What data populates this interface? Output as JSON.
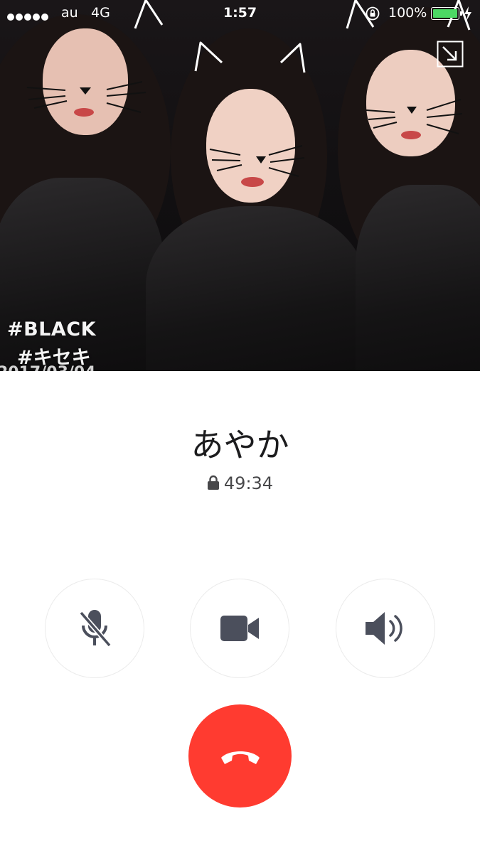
{
  "status_bar": {
    "carrier": "au",
    "network": "4G",
    "time": "1:57",
    "battery": "100%"
  },
  "photo": {
    "caption_line1": "#BLACK",
    "caption_line2": "#キセキ",
    "caption_line3": "2017/03/04"
  },
  "call": {
    "caller_name": "あやか",
    "duration": "49:34"
  },
  "controls": {
    "mute_icon": "mic-off-icon",
    "video_icon": "video-camera-icon",
    "speaker_icon": "speaker-icon",
    "end_call_icon": "phone-hangup-icon"
  },
  "colors": {
    "end_call": "#ff3b30",
    "icon": "#4b4f5c",
    "battery": "#4cd964"
  }
}
